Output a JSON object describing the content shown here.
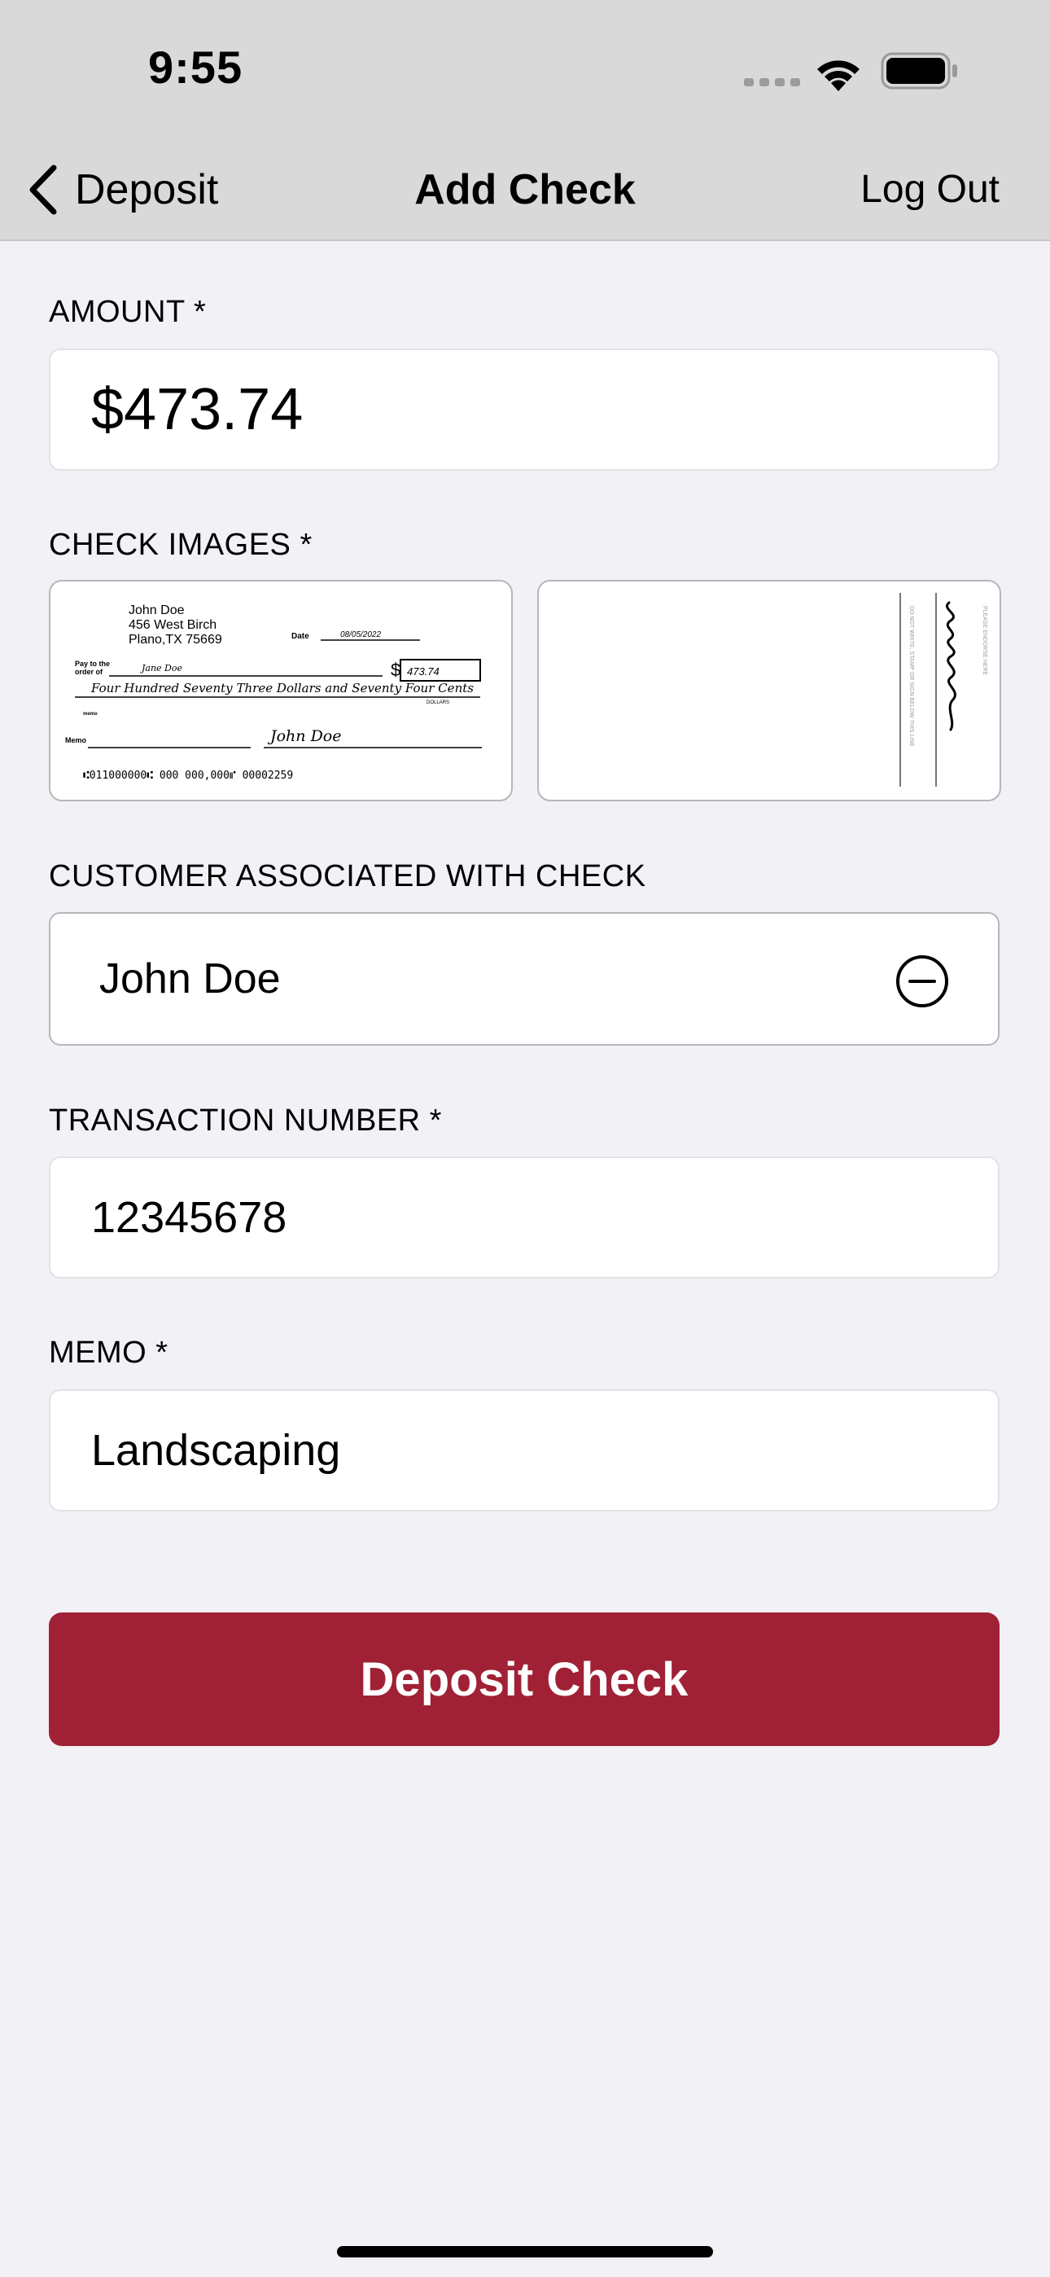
{
  "status_bar": {
    "time": "9:55"
  },
  "nav": {
    "back_label": "Deposit",
    "title": "Add Check",
    "right_action": "Log Out"
  },
  "form": {
    "amount": {
      "label": "AMOUNT *",
      "value": "$473.74"
    },
    "check_images": {
      "label": "CHECK IMAGES *",
      "front": {
        "name": "John Doe",
        "address1": "456 West Birch",
        "address2": "Plano,TX 75669",
        "date_label": "Date",
        "date": "08/05/2022",
        "pay_label_1": "Pay to the",
        "pay_label_2": "order of",
        "payee": "Jane Doe",
        "dollar_sign": "$",
        "amount": "473.74",
        "written_amount": "Four Hundred Seventy Three Dollars and Seventy Four Cents",
        "dollars_word": "DOLLARS",
        "memo_small": "memo",
        "memo_label": "Memo",
        "signature": "John Doe",
        "micr": "⑆011000000⑆ 000 000,000⑈ 00002259"
      },
      "back": {
        "endorse_text": "PLEASE ENDORSE HERE",
        "warning_text": "DO NOT WRITE, STAMP OR SIGN BELOW THIS LINE"
      }
    },
    "customer": {
      "label": "CUSTOMER ASSOCIATED WITH CHECK",
      "value": "John Doe",
      "icon": "minus-circle-icon"
    },
    "transaction": {
      "label": "TRANSACTION NUMBER *",
      "value": "12345678"
    },
    "memo": {
      "label": "MEMO *",
      "value": "Landscaping"
    },
    "submit_label": "Deposit Check"
  },
  "colors": {
    "accent": "#a02135",
    "background": "#f2f1f6",
    "bar": "#d9d9d9"
  }
}
